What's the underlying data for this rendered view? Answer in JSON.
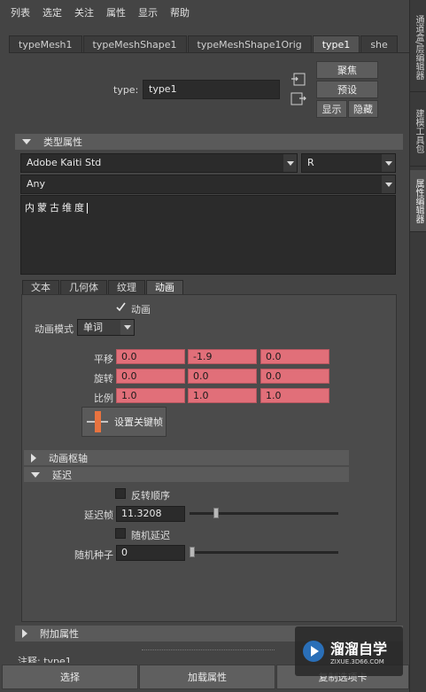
{
  "menu": [
    "列表",
    "选定",
    "关注",
    "属性",
    "显示",
    "帮助"
  ],
  "side_tabs": [
    "通道盒/层编辑器",
    "建模工具包",
    "属性编辑器"
  ],
  "node_tabs": [
    "typeMesh1",
    "typeMeshShape1",
    "typeMeshShape1Orig",
    "type1",
    "she"
  ],
  "active_node_tab": "type1",
  "type_label": "type:",
  "type_value": "type1",
  "buttons": {
    "focus": "聚焦",
    "presets": "预设",
    "show": "显示",
    "hide": "隐藏"
  },
  "type_attributes_section": "类型属性",
  "font_dropdown": "Adobe Kaiti Std",
  "style_dropdown": "R",
  "writing_system_dropdown": "Any",
  "text_content": "内蒙古维度",
  "inner_tabs": [
    "文本",
    "几何体",
    "纹理",
    "动画"
  ],
  "active_inner_tab": "动画",
  "animation": {
    "animate_label": "动画",
    "animate_checked": true,
    "mode_label": "动画模式",
    "mode_value": "单词",
    "translate_label": "平移",
    "translate": [
      "0.0",
      "-1.9",
      "0.0"
    ],
    "rotate_label": "旋转",
    "rotate": [
      "0.0",
      "0.0",
      "0.0"
    ],
    "scale_label": "比例",
    "scale": [
      "1.0",
      "1.0",
      "1.0"
    ],
    "set_key_label": "设置关键帧"
  },
  "pivot_section": "动画枢轴",
  "delay_section": "延迟",
  "delay": {
    "reverse_label": "反转顺序",
    "reverse_checked": false,
    "delay_frames_label": "延迟帧",
    "delay_frames_value": "11.3208",
    "delay_frames_fraction": 0.25,
    "random_label": "随机延迟",
    "random_checked": false,
    "seed_label": "随机种子",
    "seed_value": "0",
    "seed_fraction": 0.0
  },
  "extra_attributes_section": "附加属性",
  "notes_label": "注释: type1",
  "bottom_buttons": [
    "选择",
    "加载属性",
    "复制选项卡"
  ],
  "watermark": {
    "title": "溜溜自学",
    "url": "ZIXUE.3D66.COM"
  },
  "colors": {
    "keyed_field": "#e16f79",
    "set_key_icon": "#e8733f"
  }
}
